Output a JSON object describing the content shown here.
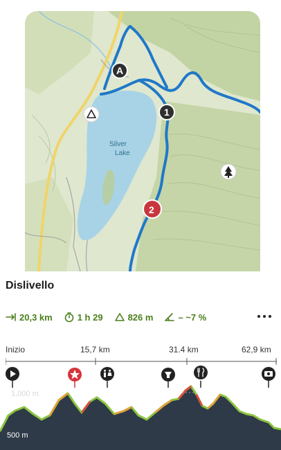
{
  "map": {
    "lake_label_line1": "Silver",
    "lake_label_line2": "Lake",
    "waypoints": [
      {
        "label": "A",
        "color": "#2f2f2f"
      },
      {
        "label": "1",
        "color": "#2f2f2f"
      },
      {
        "label": "2",
        "color": "#c8363d"
      }
    ],
    "colors": {
      "route": "#1f78c8",
      "water": "#a8d3e6",
      "land": "#dfe7cf",
      "forest": "#b9cd95",
      "road": "#f0d46a"
    },
    "icons": [
      "campsite-icon",
      "tree-icon"
    ]
  },
  "panel": {
    "title": "Dislivello",
    "stats": {
      "distance": "20,3 km",
      "duration": "1 h 29",
      "ascent": "826 m",
      "grade": "– ~7 %"
    },
    "axis": {
      "start": "Inizio",
      "km1": "15,7 km",
      "km2": "31.4 km",
      "km3": "62,9 km"
    },
    "elevation": {
      "high_label": "1,000 m",
      "low_label": "500 m"
    },
    "profile_icons": [
      "start-play-icon",
      "favorite-star-icon",
      "restroom-icon",
      "viewpoint-icon",
      "restaurant-icon",
      "photo-spot-icon"
    ]
  }
}
